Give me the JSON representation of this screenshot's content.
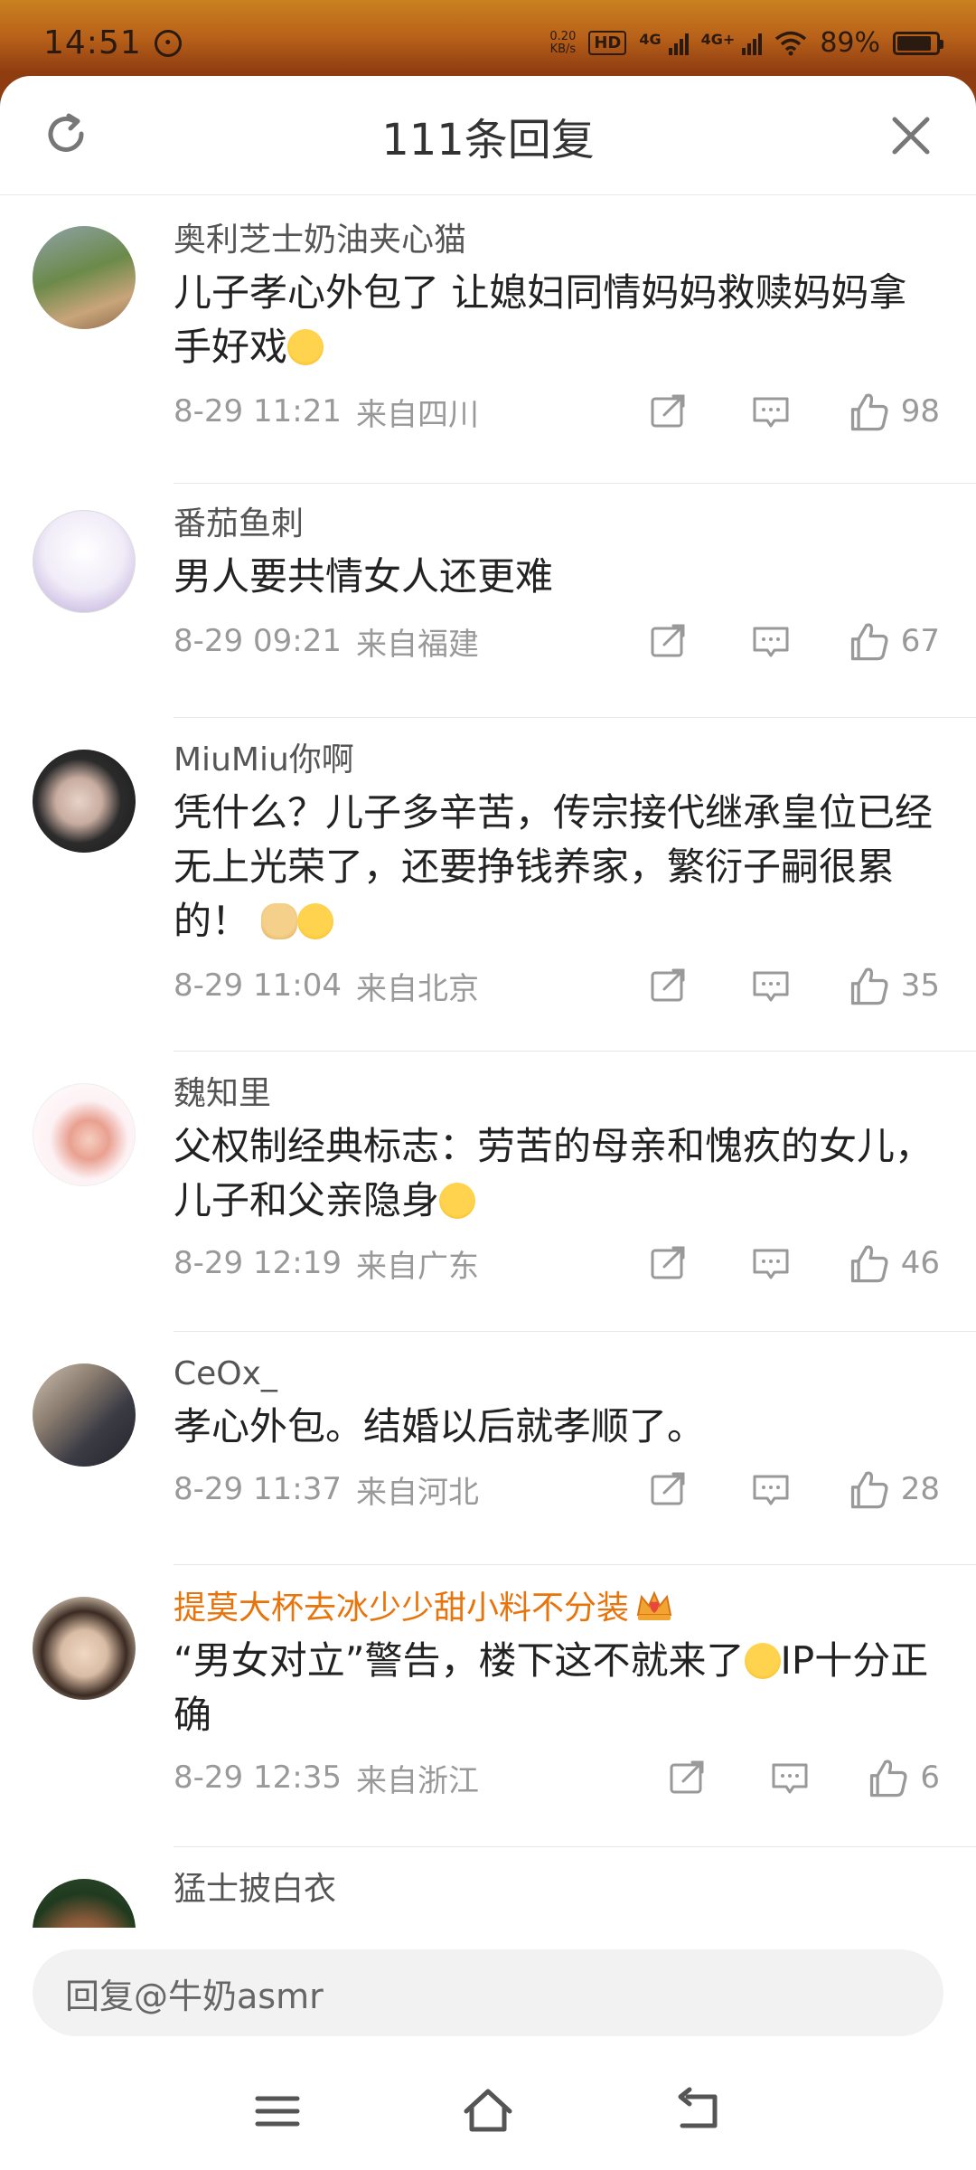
{
  "status_bar": {
    "time": "14:51",
    "net_speed_value": "0.20",
    "net_speed_unit": "KB/s",
    "hd_tag": "HD",
    "net1": "4G",
    "net2": "4G+",
    "battery": "89%",
    "battery_level": 0.89
  },
  "header": {
    "title": "111条回复",
    "refresh_icon": "refresh-icon",
    "close_icon": "close-icon"
  },
  "comments": [
    {
      "username": "奥利芝士奶油夹心猫",
      "text": "儿子孝心外包了 让媳妇同情妈妈救赎妈妈拿手好戏",
      "emoji": "tongue-emoji",
      "time": "8-29 11:21",
      "location": "来自四川",
      "likes": "98",
      "avatar_colors": [
        "#6b8a4a",
        "#c9b48a"
      ]
    },
    {
      "username": "番茄鱼刺",
      "text": "男人要共情女人还更难",
      "time": "8-29 09:21",
      "location": "来自福建",
      "likes": "67",
      "avatar_colors": [
        "#e9e4f5",
        "#8c7bb8"
      ]
    },
    {
      "username": "MiuMiu你啊",
      "text": "凭什么？儿子多辛苦，传宗接代继承皇位已经无上光荣了，还要挣钱养家，繁衍子嗣很累的！",
      "emoji": "doge-emoji laugh-emoji",
      "time": "8-29 11:04",
      "location": "来自北京",
      "likes": "35",
      "avatar_colors": [
        "#2b2b2b",
        "#d9c2b8"
      ]
    },
    {
      "username": "魏知里",
      "text": "父权制经典标志：劳苦的母亲和愧疚的女儿，儿子和父亲隐身",
      "emoji": "hug-emoji",
      "time": "8-29 12:19",
      "location": "来自广东",
      "likes": "46",
      "avatar_colors": [
        "#fbe7ec",
        "#c2785a"
      ]
    },
    {
      "username": "CeOx_",
      "text": "孝心外包。结婚以后就孝顺了。",
      "time": "8-29 11:37",
      "location": "来自河北",
      "likes": "28",
      "avatar_colors": [
        "#3b3b45",
        "#a89a8c"
      ]
    },
    {
      "username": "提莫大杯去冰少少甜小料不分装",
      "vip_badge": "crown-icon",
      "text": "“男女对立”警告，楼下这不就来了",
      "text_tail": "IP十分正确",
      "emoji": "666-emoji",
      "time": "8-29 12:35",
      "location": "来自浙江",
      "likes": "6",
      "avatar_colors": [
        "#d8c8b4",
        "#3a2a22"
      ],
      "username_color": "#e8740c"
    },
    {
      "username": "猛士披白衣",
      "avatar_colors": [
        "#1f3a1f",
        "#8a5a3a"
      ]
    }
  ],
  "action_icons": {
    "share": "share-icon",
    "comment": "comment-icon",
    "like": "thumbs-up-icon"
  },
  "reply_bar": {
    "placeholder": "回复@牛奶asmr"
  },
  "nav": {
    "menu": "menu-icon",
    "home": "home-icon",
    "back": "back-icon"
  }
}
